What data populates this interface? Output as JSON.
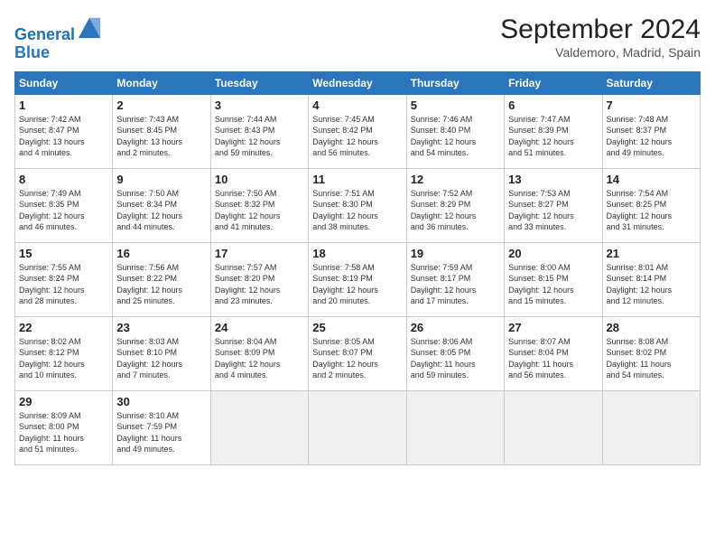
{
  "header": {
    "logo_line1": "General",
    "logo_line2": "Blue",
    "month": "September 2024",
    "location": "Valdemoro, Madrid, Spain"
  },
  "weekdays": [
    "Sunday",
    "Monday",
    "Tuesday",
    "Wednesday",
    "Thursday",
    "Friday",
    "Saturday"
  ],
  "weeks": [
    [
      {
        "day": "1",
        "detail": "Sunrise: 7:42 AM\nSunset: 8:47 PM\nDaylight: 13 hours\nand 4 minutes."
      },
      {
        "day": "2",
        "detail": "Sunrise: 7:43 AM\nSunset: 8:45 PM\nDaylight: 13 hours\nand 2 minutes."
      },
      {
        "day": "3",
        "detail": "Sunrise: 7:44 AM\nSunset: 8:43 PM\nDaylight: 12 hours\nand 59 minutes."
      },
      {
        "day": "4",
        "detail": "Sunrise: 7:45 AM\nSunset: 8:42 PM\nDaylight: 12 hours\nand 56 minutes."
      },
      {
        "day": "5",
        "detail": "Sunrise: 7:46 AM\nSunset: 8:40 PM\nDaylight: 12 hours\nand 54 minutes."
      },
      {
        "day": "6",
        "detail": "Sunrise: 7:47 AM\nSunset: 8:39 PM\nDaylight: 12 hours\nand 51 minutes."
      },
      {
        "day": "7",
        "detail": "Sunrise: 7:48 AM\nSunset: 8:37 PM\nDaylight: 12 hours\nand 49 minutes."
      }
    ],
    [
      {
        "day": "8",
        "detail": "Sunrise: 7:49 AM\nSunset: 8:35 PM\nDaylight: 12 hours\nand 46 minutes."
      },
      {
        "day": "9",
        "detail": "Sunrise: 7:50 AM\nSunset: 8:34 PM\nDaylight: 12 hours\nand 44 minutes."
      },
      {
        "day": "10",
        "detail": "Sunrise: 7:50 AM\nSunset: 8:32 PM\nDaylight: 12 hours\nand 41 minutes."
      },
      {
        "day": "11",
        "detail": "Sunrise: 7:51 AM\nSunset: 8:30 PM\nDaylight: 12 hours\nand 38 minutes."
      },
      {
        "day": "12",
        "detail": "Sunrise: 7:52 AM\nSunset: 8:29 PM\nDaylight: 12 hours\nand 36 minutes."
      },
      {
        "day": "13",
        "detail": "Sunrise: 7:53 AM\nSunset: 8:27 PM\nDaylight: 12 hours\nand 33 minutes."
      },
      {
        "day": "14",
        "detail": "Sunrise: 7:54 AM\nSunset: 8:25 PM\nDaylight: 12 hours\nand 31 minutes."
      }
    ],
    [
      {
        "day": "15",
        "detail": "Sunrise: 7:55 AM\nSunset: 8:24 PM\nDaylight: 12 hours\nand 28 minutes."
      },
      {
        "day": "16",
        "detail": "Sunrise: 7:56 AM\nSunset: 8:22 PM\nDaylight: 12 hours\nand 25 minutes."
      },
      {
        "day": "17",
        "detail": "Sunrise: 7:57 AM\nSunset: 8:20 PM\nDaylight: 12 hours\nand 23 minutes."
      },
      {
        "day": "18",
        "detail": "Sunrise: 7:58 AM\nSunset: 8:19 PM\nDaylight: 12 hours\nand 20 minutes."
      },
      {
        "day": "19",
        "detail": "Sunrise: 7:59 AM\nSunset: 8:17 PM\nDaylight: 12 hours\nand 17 minutes."
      },
      {
        "day": "20",
        "detail": "Sunrise: 8:00 AM\nSunset: 8:15 PM\nDaylight: 12 hours\nand 15 minutes."
      },
      {
        "day": "21",
        "detail": "Sunrise: 8:01 AM\nSunset: 8:14 PM\nDaylight: 12 hours\nand 12 minutes."
      }
    ],
    [
      {
        "day": "22",
        "detail": "Sunrise: 8:02 AM\nSunset: 8:12 PM\nDaylight: 12 hours\nand 10 minutes."
      },
      {
        "day": "23",
        "detail": "Sunrise: 8:03 AM\nSunset: 8:10 PM\nDaylight: 12 hours\nand 7 minutes."
      },
      {
        "day": "24",
        "detail": "Sunrise: 8:04 AM\nSunset: 8:09 PM\nDaylight: 12 hours\nand 4 minutes."
      },
      {
        "day": "25",
        "detail": "Sunrise: 8:05 AM\nSunset: 8:07 PM\nDaylight: 12 hours\nand 2 minutes."
      },
      {
        "day": "26",
        "detail": "Sunrise: 8:06 AM\nSunset: 8:05 PM\nDaylight: 11 hours\nand 59 minutes."
      },
      {
        "day": "27",
        "detail": "Sunrise: 8:07 AM\nSunset: 8:04 PM\nDaylight: 11 hours\nand 56 minutes."
      },
      {
        "day": "28",
        "detail": "Sunrise: 8:08 AM\nSunset: 8:02 PM\nDaylight: 11 hours\nand 54 minutes."
      }
    ],
    [
      {
        "day": "29",
        "detail": "Sunrise: 8:09 AM\nSunset: 8:00 PM\nDaylight: 11 hours\nand 51 minutes."
      },
      {
        "day": "30",
        "detail": "Sunrise: 8:10 AM\nSunset: 7:59 PM\nDaylight: 11 hours\nand 49 minutes."
      },
      {
        "day": "",
        "detail": "",
        "empty": true
      },
      {
        "day": "",
        "detail": "",
        "empty": true
      },
      {
        "day": "",
        "detail": "",
        "empty": true
      },
      {
        "day": "",
        "detail": "",
        "empty": true
      },
      {
        "day": "",
        "detail": "",
        "empty": true
      }
    ]
  ]
}
